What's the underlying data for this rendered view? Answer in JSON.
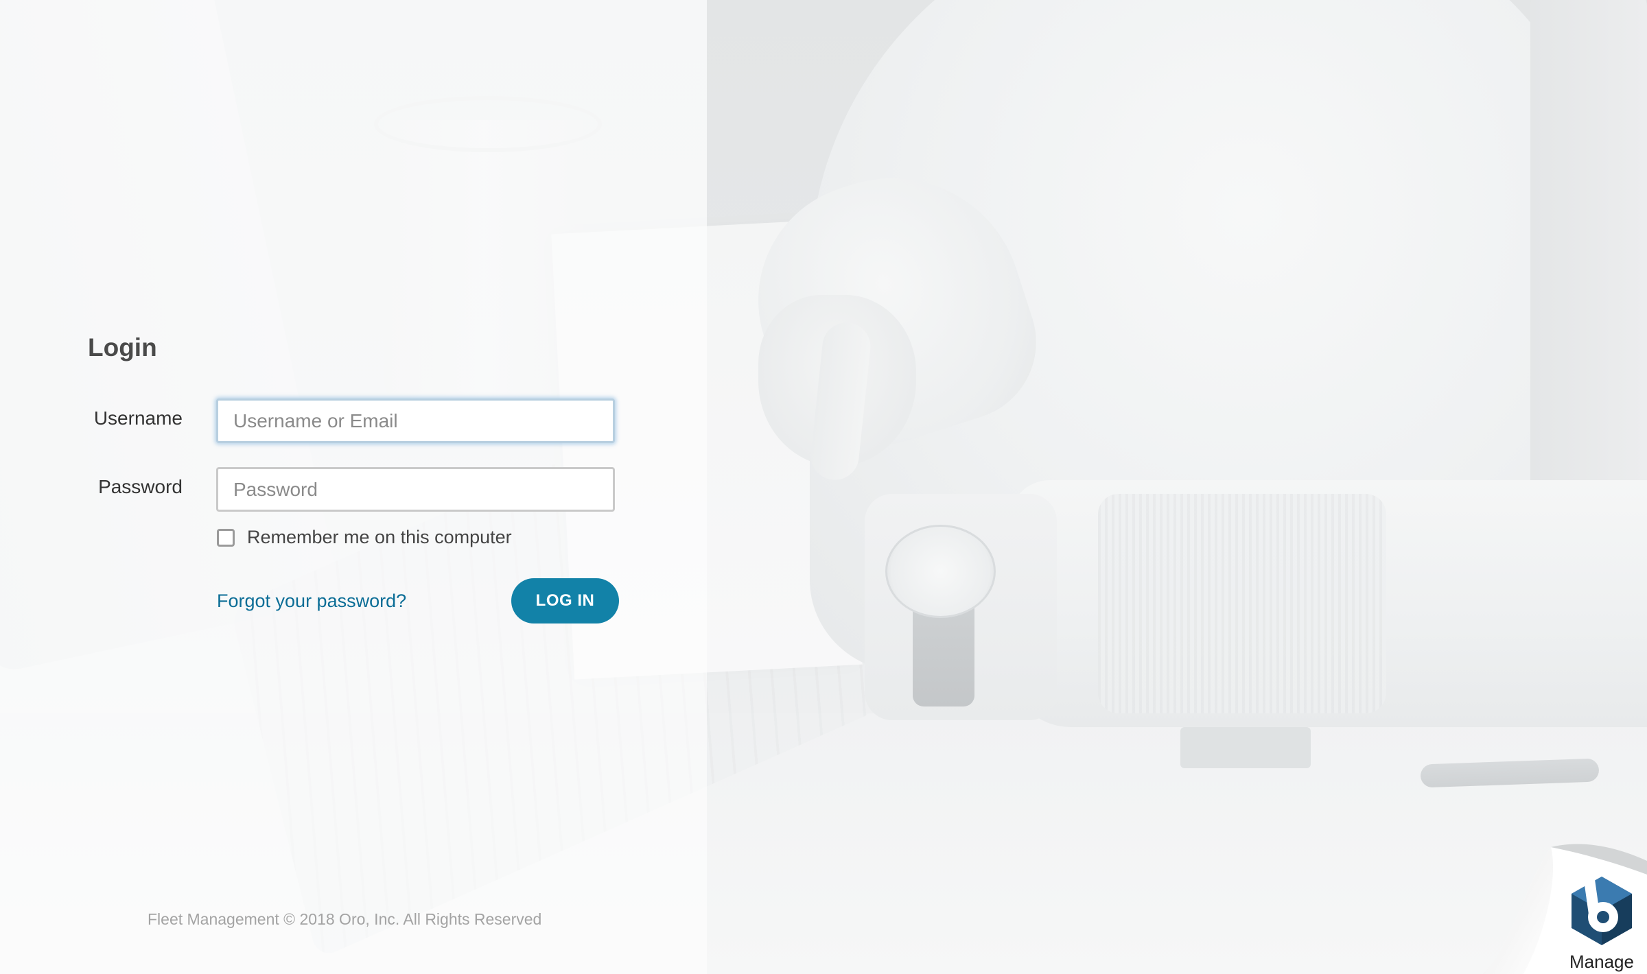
{
  "login": {
    "title": "Login",
    "username_label": "Username",
    "username_placeholder": "Username or Email",
    "password_label": "Password",
    "password_placeholder": "Password",
    "remember_label": "Remember me on this computer",
    "remember_checked": false,
    "forgot_link": "Forgot your password?",
    "submit_label": "LOG IN"
  },
  "footer": {
    "copyright": "Fleet Management © 2018 Oro, Inc. All Rights Reserved"
  },
  "brand": {
    "label": "Manage",
    "icon": "hexagon-b-logo-icon"
  },
  "colors": {
    "accent": "#1282a8",
    "link": "#0b6d96",
    "logo_dark": "#1f4e74",
    "logo_light": "#3b7bb0"
  }
}
